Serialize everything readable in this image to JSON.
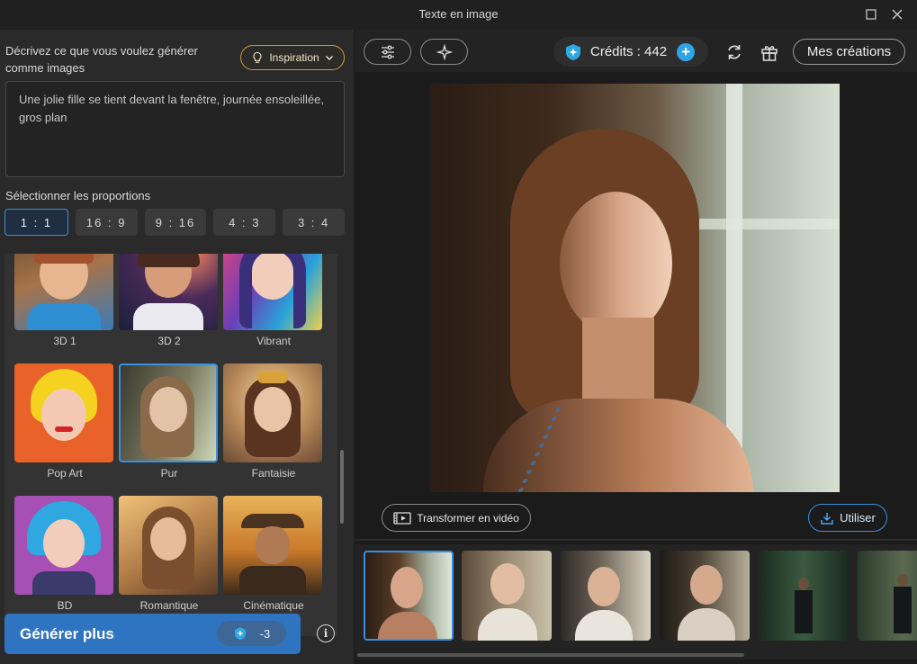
{
  "window": {
    "title": "Texte en image",
    "maximize_icon": "square-outline",
    "close_icon": "x-mark"
  },
  "left": {
    "prompt_label": "Décrivez ce que vous voulez générer comme images",
    "inspiration_label": "Inspiration",
    "prompt_text": "Une  jolie fille se tient devant la fenêtre, journée ensoleillée, gros plan",
    "ratio_label": "Sélectionner les proportions",
    "ratios": [
      "1 : 1",
      "16 : 9",
      "9 : 16",
      "4 : 3",
      "3 : 4"
    ],
    "selected_ratio": "1 : 1",
    "styles": [
      {
        "name": "3D 1"
      },
      {
        "name": "3D 2"
      },
      {
        "name": "Vibrant"
      },
      {
        "name": "Pop Art"
      },
      {
        "name": "Pur"
      },
      {
        "name": "Fantaisie"
      },
      {
        "name": "BD"
      },
      {
        "name": "Romantique"
      },
      {
        "name": "Cinématique"
      }
    ],
    "selected_style": "Pur",
    "generate_label": "Générer plus",
    "generate_cost": "-3"
  },
  "right": {
    "credits_label": "Crédits : 442",
    "mes_creations_label": "Mes créations",
    "transform_label": "Transformer en vidéo",
    "use_label": "Utiliser"
  },
  "colors": {
    "accent_blue": "#3a8fe0",
    "generate_bg": "#2f74c0",
    "inspiration_border": "#c99b3d",
    "credits_plus": "#2fa3e8"
  }
}
